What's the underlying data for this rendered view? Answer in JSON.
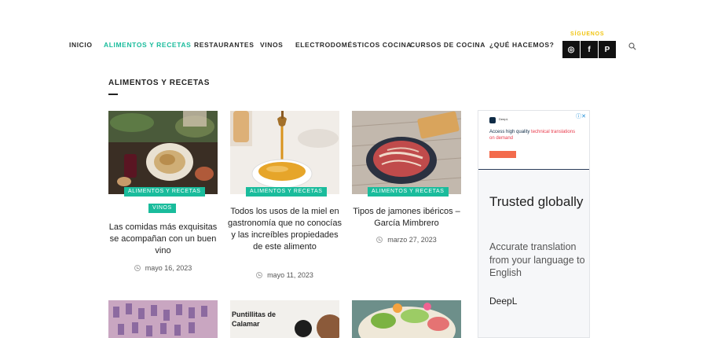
{
  "nav": {
    "items": [
      {
        "label": "INICIO",
        "active": false
      },
      {
        "label": "ALIMENTOS Y RECETAS",
        "active": true
      },
      {
        "label": "RESTAURANTES",
        "active": false
      },
      {
        "label": "VINOS",
        "active": false
      },
      {
        "label": "ELECTRODOMÉSTICOS COCINA",
        "active": false
      },
      {
        "label": "CURSOS DE COCINA",
        "active": false
      },
      {
        "label": "¿QUÉ HACEMOS?",
        "active": false
      }
    ],
    "follow_label": "SÍGUENOS",
    "social": [
      {
        "icon": "instagram-icon",
        "glyph": "◎"
      },
      {
        "icon": "facebook-icon",
        "glyph": "f"
      },
      {
        "icon": "pinterest-icon",
        "glyph": "P"
      }
    ],
    "search_icon": "search-icon",
    "accent_color": "#1abc9c"
  },
  "section": {
    "title": "ALIMENTOS Y RECETAS"
  },
  "posts": [
    {
      "tags": [
        "ALIMENTOS Y RECETAS",
        "VINOS"
      ],
      "title": "Las comidas más exquisitas se acompañan con un buen vino",
      "date": "mayo 16, 2023"
    },
    {
      "tags": [
        "ALIMENTOS Y RECETAS"
      ],
      "title": "Todos los usos de la miel en gastronomía que no conocías y las increíbles propiedades de este alimento",
      "date": "mayo 11, 2023"
    },
    {
      "tags": [
        "ALIMENTOS Y RECETAS"
      ],
      "title": "Tipos de jamones ibéricos – García Mimbrero",
      "date": "marzo 27, 2023"
    }
  ],
  "next_row": {
    "second_thumb_text": "Puntillitas de Calamar"
  },
  "ad": {
    "banner_headline_part1": "Access high quality",
    "banner_headline_part2": "technical translations on demand",
    "title": "Trusted globally",
    "body": "Accurate translation from your language to English",
    "brand": "DeepL"
  }
}
